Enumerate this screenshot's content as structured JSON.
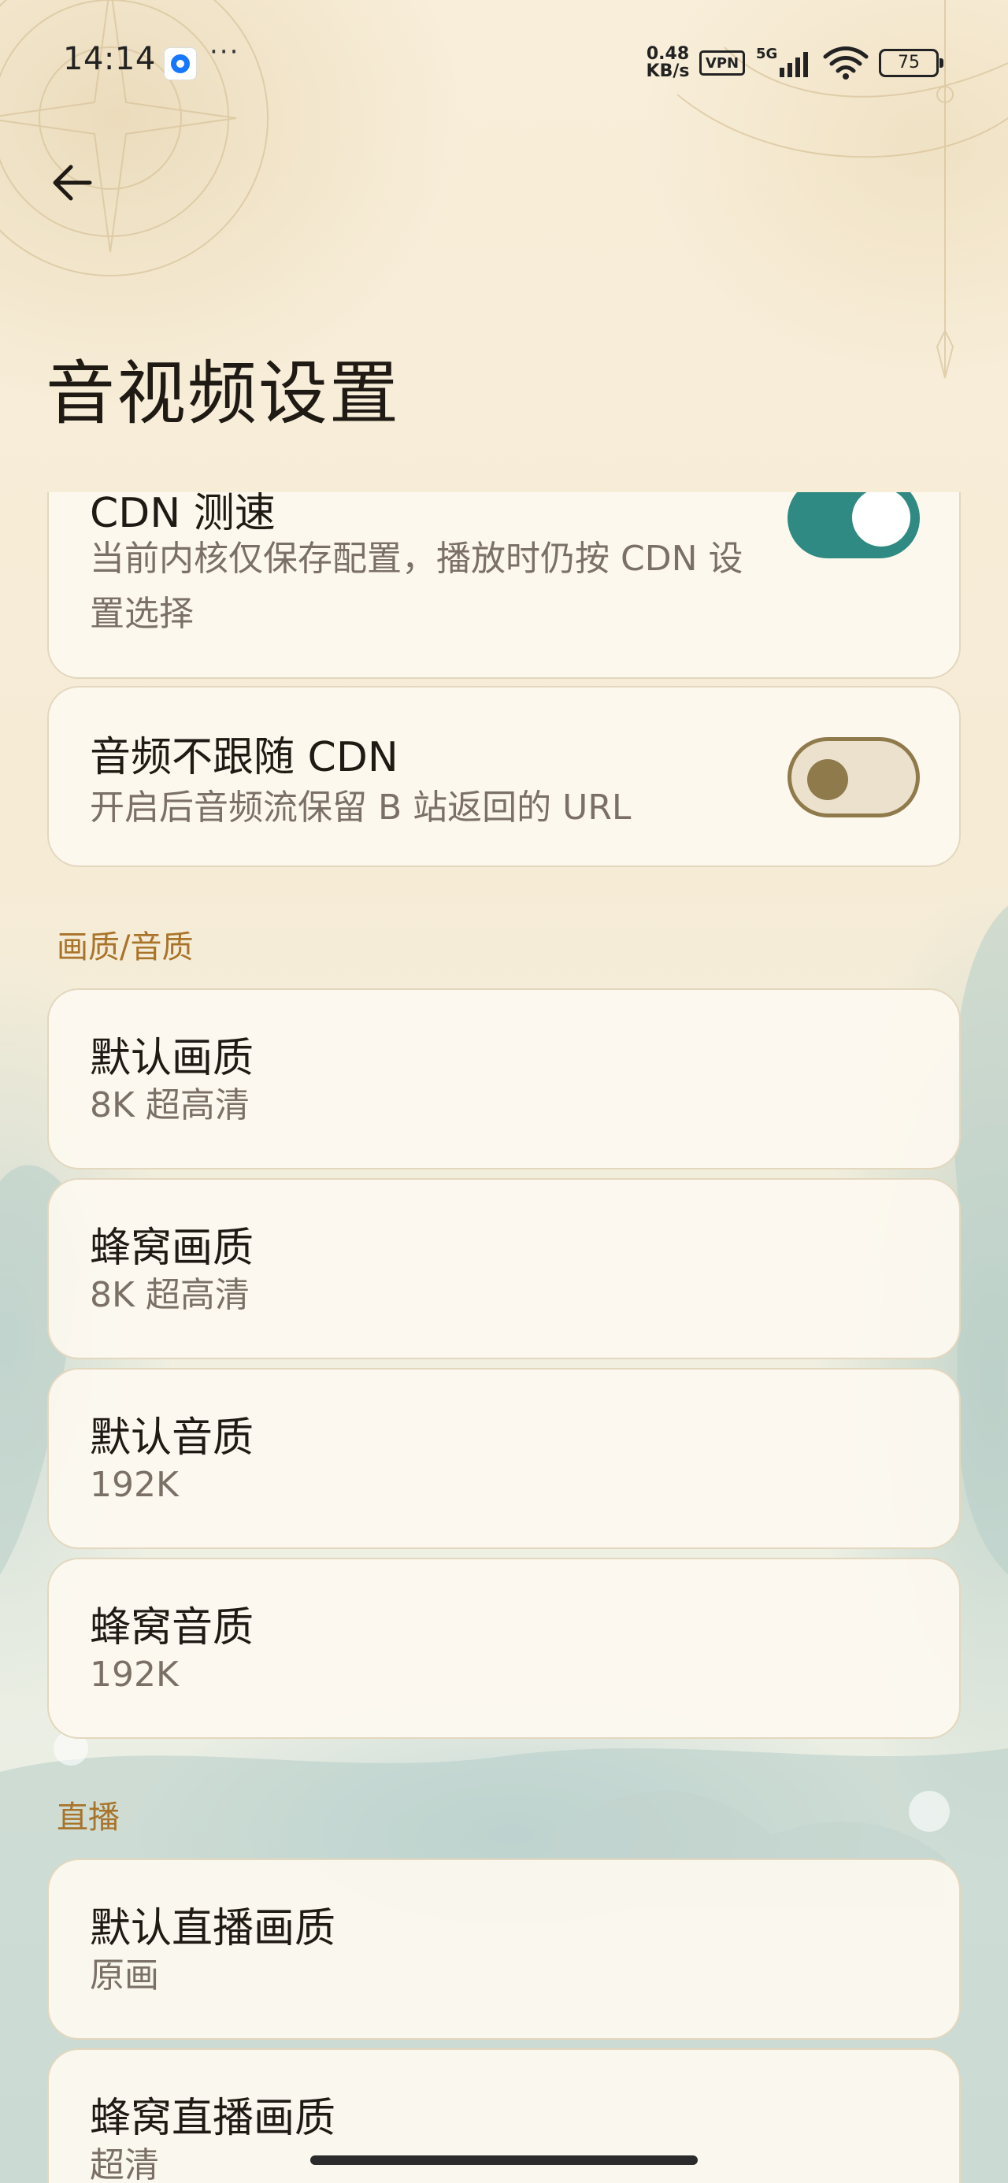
{
  "status_bar": {
    "time": "14:14",
    "more": "···",
    "net_speed_value": "0.48",
    "net_speed_unit": "KB/s",
    "vpn": "VPN",
    "network_type": "5G",
    "battery": "75"
  },
  "header": {
    "title": "音视频设置"
  },
  "cdn_speed_card": {
    "title": "CDN 测速",
    "subtitle": "当前内核仅保存配置，播放时仍按 CDN 设置选择",
    "toggle_on": true
  },
  "audio_cdn_card": {
    "title": "音频不跟随 CDN",
    "subtitle": "开启后音频流保留 B 站返回的 URL",
    "toggle_on": false
  },
  "quality_section": {
    "header": "画质/音质",
    "items": [
      {
        "title": "默认画质",
        "value": "8K 超高清"
      },
      {
        "title": "蜂窝画质",
        "value": "8K 超高清"
      },
      {
        "title": "默认音质",
        "value": "192K"
      },
      {
        "title": "蜂窝音质",
        "value": "192K"
      }
    ]
  },
  "live_section": {
    "header": "直播",
    "items": [
      {
        "title": "默认直播画质",
        "value": "原画"
      },
      {
        "title": "蜂窝直播画质",
        "value": "超清"
      }
    ]
  },
  "colors": {
    "accent": "#2e8a82",
    "section_header": "#a9742a",
    "toggle_off": "#8f7a4c"
  }
}
